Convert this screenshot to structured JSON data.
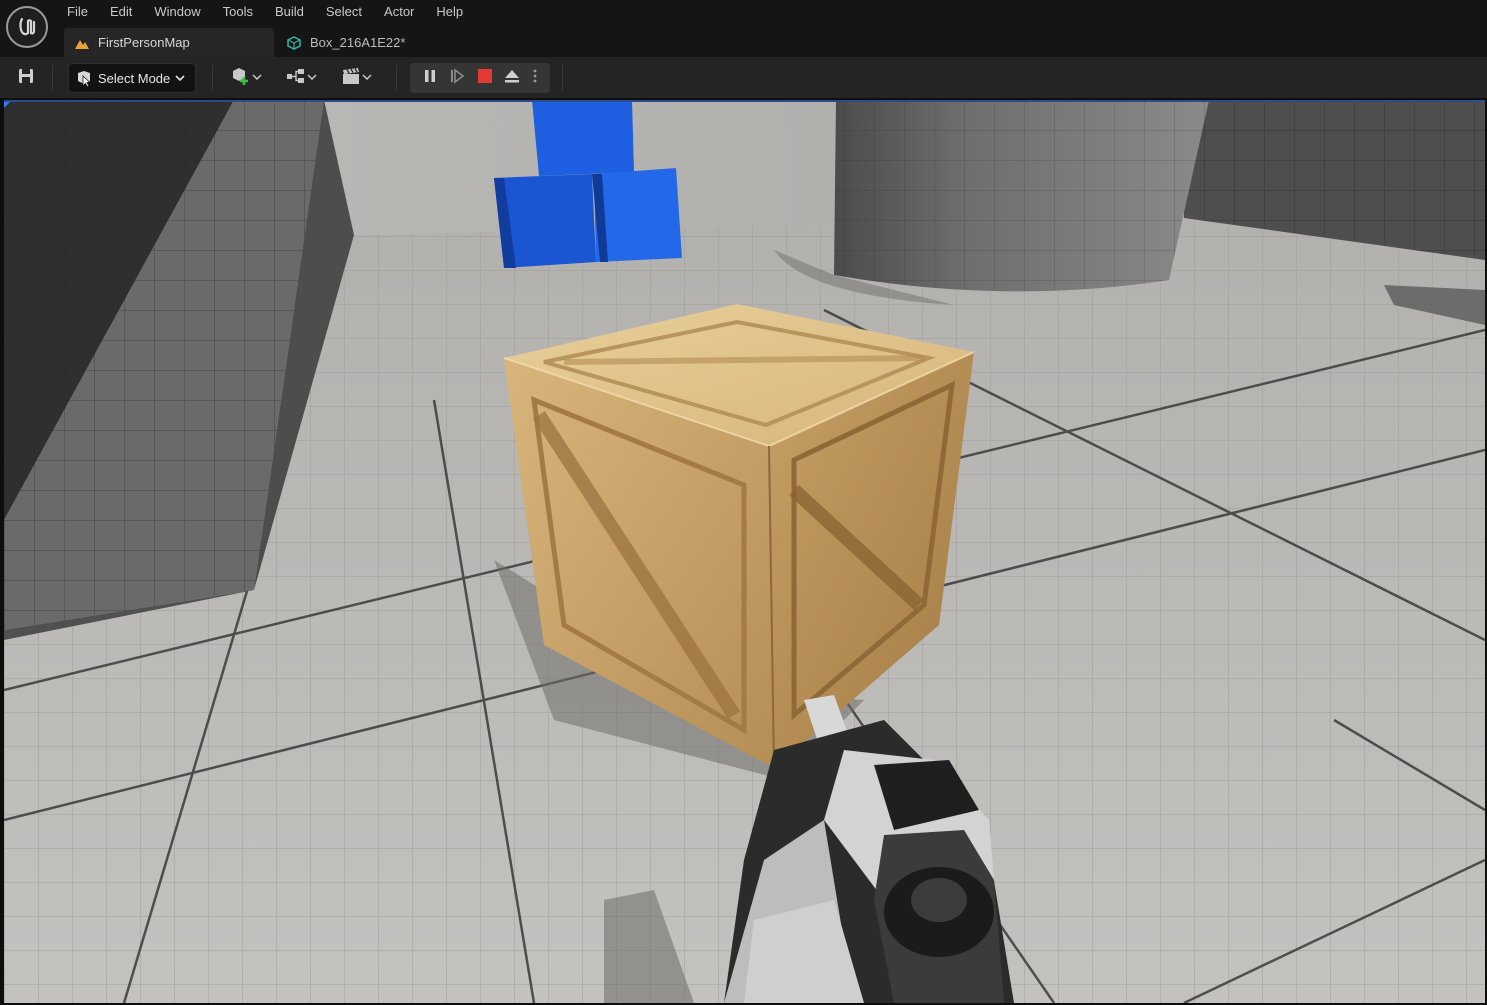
{
  "menu": [
    "File",
    "Edit",
    "Window",
    "Tools",
    "Build",
    "Select",
    "Actor",
    "Help"
  ],
  "tabs": [
    {
      "label": "FirstPersonMap",
      "active": true,
      "icon": "level-icon"
    },
    {
      "label": "Box_216A1E22*",
      "active": false,
      "icon": "static-mesh-icon"
    }
  ],
  "toolbar": {
    "mode_label": "Select Mode"
  },
  "colors": {
    "accent_blue": "#1f5ad6",
    "stop_red": "#e53935",
    "titlebar": "#151515",
    "toolbar": "#242424"
  }
}
